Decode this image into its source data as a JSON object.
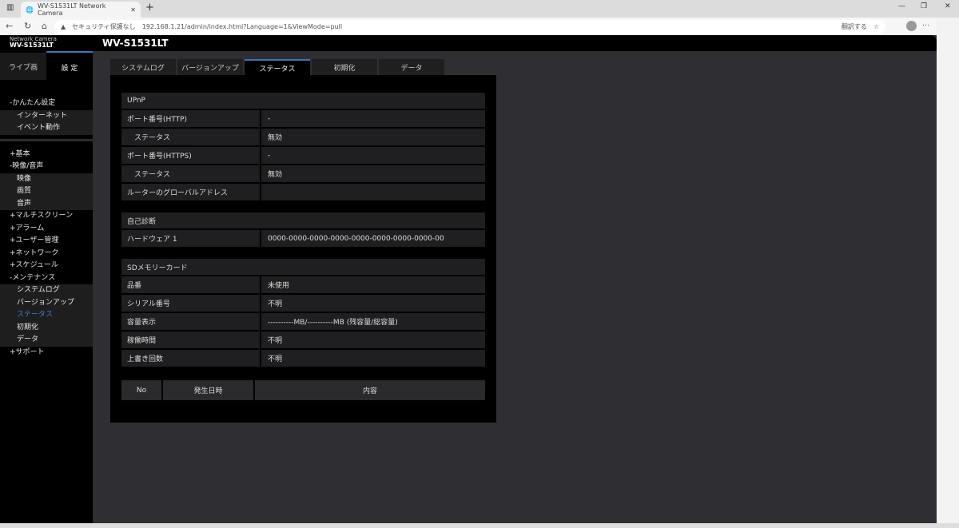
{
  "browser": {
    "tab_title": "WV-S1531LT Network Camera",
    "security": "セキュリティ保護なし",
    "url": "192.168.1.21/admin/index.html?Language=1&ViewMode=pull",
    "translate": "翻訳する"
  },
  "header": {
    "model_small_label": "Network Camera",
    "model_small": "WV-S1531LT",
    "title": "WV-S1531LT"
  },
  "side_tabs": {
    "live": "ライブ画",
    "settings": "設 定"
  },
  "menu": {
    "group1": [
      {
        "label": "-かんたん設定"
      },
      {
        "label": "インターネット",
        "sub": true
      },
      {
        "label": "イベント動作",
        "sub": true
      }
    ],
    "group2": [
      {
        "label": "+基本"
      },
      {
        "label": "-映像/音声"
      },
      {
        "label": "映像",
        "sub": true
      },
      {
        "label": "画質",
        "sub": true
      },
      {
        "label": "音声",
        "sub": true
      },
      {
        "label": "+マルチスクリーン"
      },
      {
        "label": "+アラーム"
      },
      {
        "label": "+ユーザー管理"
      },
      {
        "label": "+ネットワーク"
      },
      {
        "label": "+スケジュール"
      },
      {
        "label": "-メンテナンス"
      },
      {
        "label": "システムログ",
        "sub": true
      },
      {
        "label": "バージョンアップ",
        "sub": true
      },
      {
        "label": "ステータス",
        "sub": true,
        "active": true
      },
      {
        "label": "初期化",
        "sub": true
      },
      {
        "label": "データ",
        "sub": true
      },
      {
        "label": "+サポート"
      }
    ]
  },
  "tabs": [
    "システムログ",
    "バージョンアップ",
    "ステータス",
    "初期化",
    "データ"
  ],
  "active_tab": "ステータス",
  "upnp": {
    "title": "UPnP",
    "rows": [
      {
        "label": "ポート番号(HTTP)",
        "value": "-"
      },
      {
        "label": "ステータス",
        "value": "無効",
        "indent": true
      },
      {
        "label": "ポート番号(HTTPS)",
        "value": "-"
      },
      {
        "label": "ステータス",
        "value": "無効",
        "indent": true
      },
      {
        "label": "ルーターのグローバルアドレス",
        "value": ""
      }
    ]
  },
  "diag": {
    "title": "自己診断",
    "rows": [
      {
        "label": "ハードウェア 1",
        "value": "0000-0000-0000-0000-0000-0000-0000-0000-00"
      }
    ]
  },
  "sd": {
    "title": "SDメモリーカード",
    "rows": [
      {
        "label": "品番",
        "value": "未使用"
      },
      {
        "label": "シリアル番号",
        "value": "不明"
      },
      {
        "label": "容量表示",
        "value": "----------MB/----------MB (残容量/総容量)"
      },
      {
        "label": "稼働時間",
        "value": "不明"
      },
      {
        "label": "上書き回数",
        "value": "不明"
      }
    ]
  },
  "log": {
    "columns": [
      "No",
      "発生日時",
      "内容"
    ]
  },
  "colors": {
    "accent": "#3f74b5",
    "active_menu": "#4a7fc6"
  }
}
